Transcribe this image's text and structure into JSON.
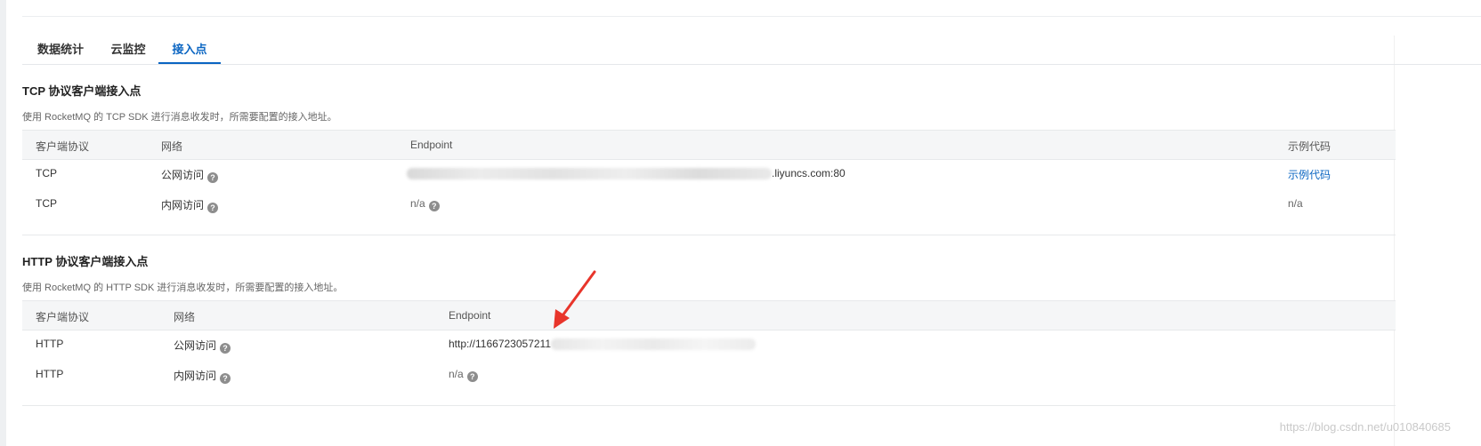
{
  "tabs": [
    {
      "label": "数据统计",
      "active": false
    },
    {
      "label": "云监控",
      "active": false
    },
    {
      "label": "接入点",
      "active": true
    }
  ],
  "tcp": {
    "title": "TCP 协议客户端接入点",
    "description": "使用 RocketMQ 的 TCP SDK 进行消息收发时，所需要配置的接入地址。",
    "headers": [
      "客户端协议",
      "网络",
      "Endpoint",
      "示例代码"
    ],
    "rows": [
      {
        "protocol": "TCP",
        "network": "公网访问",
        "endpoint_suffix": ".liyuncs.com:80",
        "endpoint_redacted": true,
        "sample": "示例代码",
        "sample_is_link": true
      },
      {
        "protocol": "TCP",
        "network": "内网访问",
        "endpoint": "n/a",
        "sample": "n/a",
        "sample_is_link": false
      }
    ]
  },
  "http": {
    "title": "HTTP 协议客户端接入点",
    "description": "使用 RocketMQ 的 HTTP SDK 进行消息收发时，所需要配置的接入地址。",
    "headers": [
      "客户端协议",
      "网络",
      "Endpoint"
    ],
    "rows": [
      {
        "protocol": "HTTP",
        "network": "公网访问",
        "endpoint_prefix": "http://1166723057211",
        "endpoint_redacted": true
      },
      {
        "protocol": "HTTP",
        "network": "内网访问",
        "endpoint": "n/a"
      }
    ]
  },
  "help_icon_glyph": "?",
  "accent_color": "#0a65c2",
  "arrow_color": "#e8352b",
  "watermark": "https://blog.csdn.net/u010840685"
}
